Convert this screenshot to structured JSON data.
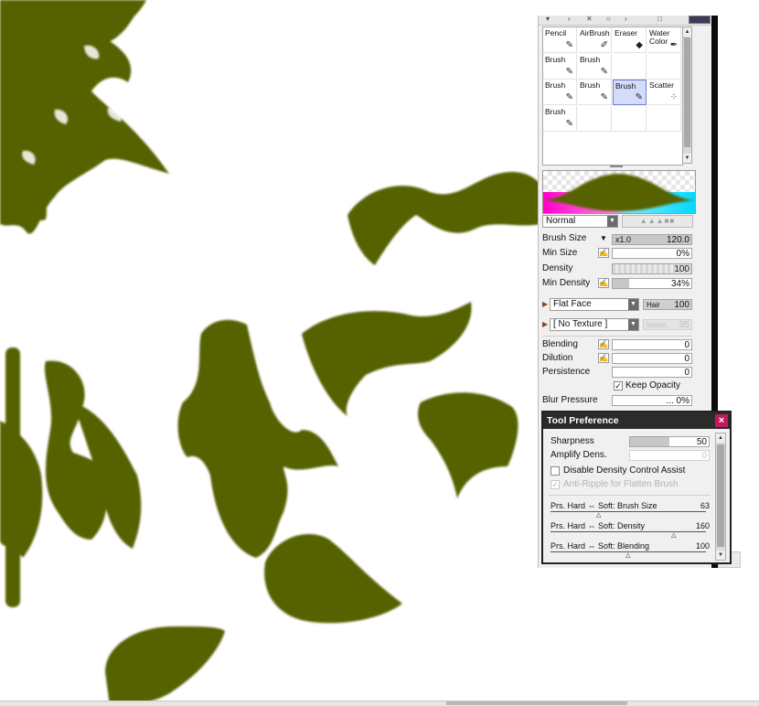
{
  "colors": {
    "paint": "#566206",
    "preview_magenta": "#ff00c8",
    "preview_cyan": "#00d8ff",
    "selected_tool": "#d3dcf9"
  },
  "tools": [
    {
      "label": "Pencil",
      "icon": "pencil-icon",
      "glyph": "✎"
    },
    {
      "label": "AirBrush",
      "icon": "airbrush-icon",
      "glyph": "✐"
    },
    {
      "label": "Eraser",
      "icon": "eraser-icon",
      "glyph": "◆"
    },
    {
      "label": "Water\nColor",
      "icon": "watercolor-icon",
      "glyph": "✒"
    },
    {
      "label": "Brush",
      "icon": "brush-icon",
      "glyph": "✎"
    },
    {
      "label": "Brush",
      "icon": "brush-icon",
      "glyph": "✎"
    },
    {
      "label": "",
      "icon": "",
      "glyph": ""
    },
    {
      "label": "",
      "icon": "",
      "glyph": ""
    },
    {
      "label": "Brush",
      "icon": "brush-icon",
      "glyph": "✎"
    },
    {
      "label": "Brush",
      "icon": "brush-icon",
      "glyph": "✎"
    },
    {
      "label": "Brush",
      "icon": "brush-icon",
      "glyph": "✎",
      "selected": true
    },
    {
      "label": "Scatter",
      "icon": "scatter-icon",
      "glyph": "⁘"
    },
    {
      "label": "Brush",
      "icon": "brush-icon",
      "glyph": "✎"
    },
    {
      "label": "",
      "icon": "",
      "glyph": ""
    },
    {
      "label": "",
      "icon": "",
      "glyph": ""
    },
    {
      "label": "",
      "icon": "",
      "glyph": ""
    }
  ],
  "blend_mode": "Normal",
  "brush_size": {
    "label": "Brush Size",
    "multiplier": "x1.0",
    "value": "120.0"
  },
  "min_size": {
    "label": "Min Size",
    "value": "0%"
  },
  "density": {
    "label": "Density",
    "value": "100"
  },
  "min_density": {
    "label": "Min Density",
    "value": "34%",
    "level": 0.34
  },
  "shape": {
    "value": "Flat Face",
    "sub_label": "Hair",
    "sub_value": "100"
  },
  "texture": {
    "value": "[ No Texture ]",
    "sub_label": "Intens.",
    "sub_value": "95"
  },
  "blending": {
    "label": "Blending",
    "value": "0"
  },
  "dilution": {
    "label": "Dilution",
    "value": "0"
  },
  "persistence": {
    "label": "Persistence",
    "value": "0"
  },
  "keep_opacity": {
    "label": "Keep Opacity",
    "checked": true
  },
  "blur_pressure": {
    "label": "Blur Pressure",
    "value": "... 0%"
  },
  "pref": {
    "title": "Tool Preference",
    "close": "×",
    "sharpness": {
      "label": "Sharpness",
      "value": "50",
      "level": 0.5
    },
    "amplify": {
      "label": "Amplify Dens.",
      "value": "0"
    },
    "disable_assist": "Disable Density Control Assist",
    "anti_ripple": "Anti-Ripple for Flatten Brush",
    "sliders": [
      {
        "label": "Prs. Hard ⇔ Soft: Brush Size",
        "value": "63"
      },
      {
        "label": "Prs. Hard ⇔ Soft: Density",
        "value": "160"
      },
      {
        "label": "Prs. Hard ⇔ Soft: Blending",
        "value": "100"
      }
    ]
  }
}
